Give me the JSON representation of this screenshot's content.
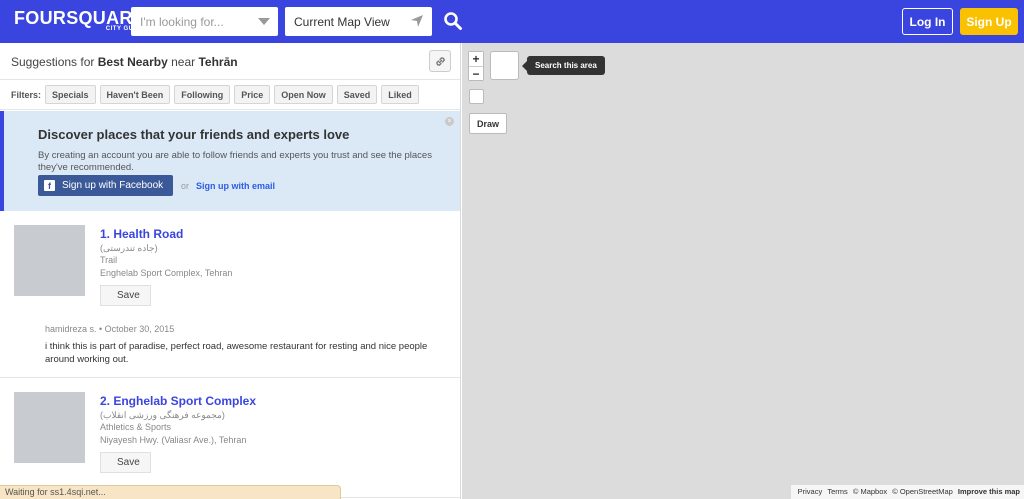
{
  "header": {
    "logo": "FOURSQUARE",
    "logo_sub": "CITY GUIDE",
    "search_placeholder": "I'm looking for...",
    "location_value": "Current Map View",
    "login_label": "Log In",
    "signup_label": "Sign Up"
  },
  "suggestions": {
    "prefix": "Suggestions for",
    "category": "Best Nearby",
    "near": "near",
    "city": "Tehrān"
  },
  "filters": {
    "label": "Filters:",
    "items": [
      "Specials",
      "Haven't Been",
      "Following",
      "Price",
      "Open Now",
      "Saved",
      "Liked"
    ]
  },
  "promo": {
    "title": "Discover places that your friends and experts love",
    "body": "By creating an account you are able to follow friends and experts you trust and see the places they've recommended.",
    "facebook_label": "Sign up with Facebook",
    "or": "or",
    "email_label": "Sign up with email"
  },
  "venues": [
    {
      "name": "1. Health Road",
      "native": "(جاده تندرستی)",
      "category": "Trail",
      "address": "Enghelab Sport Complex, Tehran",
      "save_label": "Save",
      "tip_meta": "hamidreza s. • October 30, 2015",
      "tip_text": "i think this is part of paradise, perfect road, awesome restaurant for resting and nice people around working out."
    },
    {
      "name": "2. Enghelab Sport Complex",
      "native": "(مجموعه فرهنگی ورزشی انقلاب)",
      "category": "Athletics & Sports",
      "address": "Niyayesh Hwy. (Valiasr Ave.), Tehran",
      "save_label": "Save"
    }
  ],
  "status": "Waiting for ss1.4sqi.net...",
  "map": {
    "zoom_in": "+",
    "zoom_out": "−",
    "search_area": "Search this area",
    "draw_label": "Draw",
    "attribution": {
      "privacy": "Privacy",
      "terms": "Terms",
      "mapbox": "© Mapbox",
      "osm": "© OpenStreetMap",
      "improve": "Improve this map"
    }
  },
  "colors": {
    "brand": "#3a45e0",
    "signup": "#f9c100",
    "facebook": "#3b5998",
    "promo_bg": "#dbe9f7"
  }
}
